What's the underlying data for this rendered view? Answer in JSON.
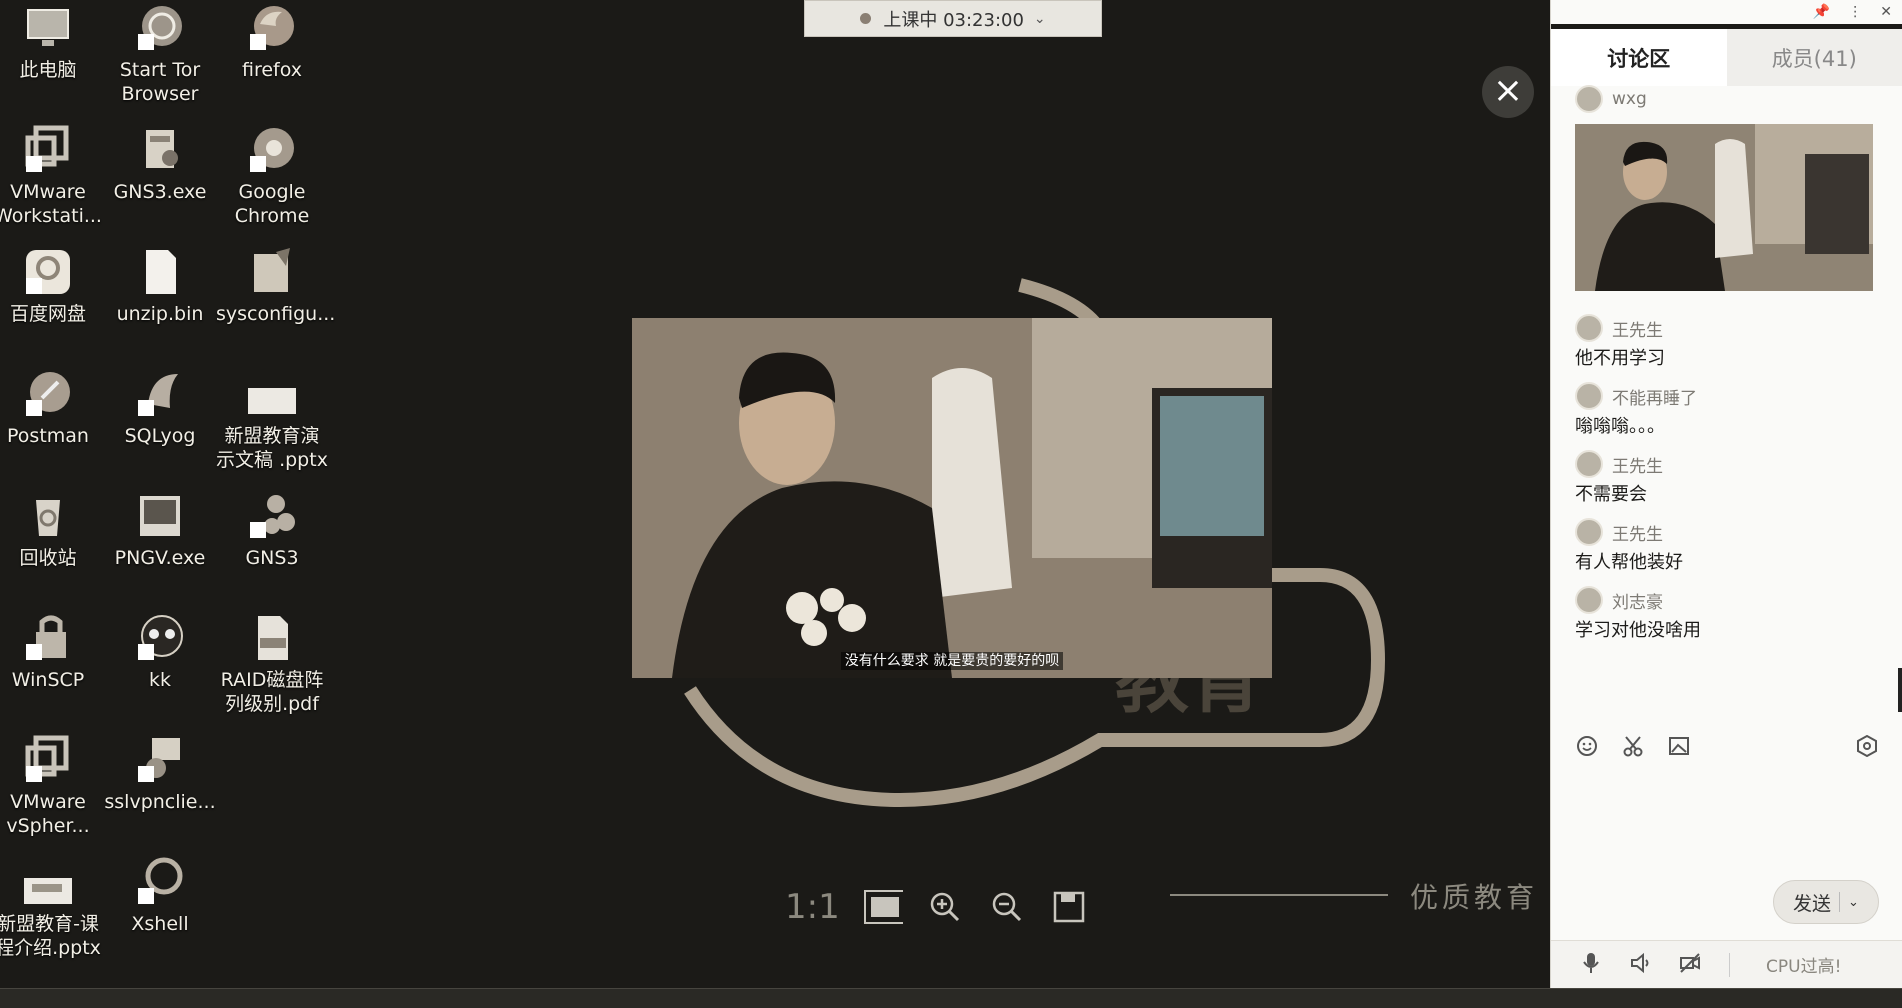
{
  "desktop": {
    "icons": [
      {
        "label": "此电脑",
        "icon": "computer-icon"
      },
      {
        "label": "Start Tor Browser",
        "icon": "tor-browser-icon"
      },
      {
        "label": "firefox",
        "icon": "firefox-icon"
      },
      {
        "label": "VMware Workstati...",
        "icon": "vmware-icon"
      },
      {
        "label": "GNS3.exe",
        "icon": "gns3-exe-icon"
      },
      {
        "label": "Google Chrome",
        "icon": "chrome-icon"
      },
      {
        "label": "百度网盘",
        "icon": "baidu-netdisk-icon"
      },
      {
        "label": "unzip.bin",
        "icon": "file-icon"
      },
      {
        "label": "sysconfigu...",
        "icon": "sysconfig-icon"
      },
      {
        "label": "Postman",
        "icon": "postman-icon"
      },
      {
        "label": "SQLyog",
        "icon": "sqlyog-icon"
      },
      {
        "label": "新盟教育演示文稿 .pptx",
        "icon": "pptx-icon"
      },
      {
        "label": "回收站",
        "icon": "recycle-bin-icon"
      },
      {
        "label": "PNGV.exe",
        "icon": "pngv-icon"
      },
      {
        "label": "GNS3",
        "icon": "gns3-icon"
      },
      {
        "label": "WinSCP",
        "icon": "winscp-icon"
      },
      {
        "label": "kk",
        "icon": "kk-icon"
      },
      {
        "label": "RAID磁盘阵列级别.pdf",
        "icon": "pdf-icon"
      },
      {
        "label": "VMware vSpher...",
        "icon": "vsphere-icon"
      },
      {
        "label": "sslvpnclie...",
        "icon": "sslvpn-icon"
      },
      {
        "label": "新盟教育-课程介绍.pptx",
        "icon": "pptx-icon"
      },
      {
        "label": "Xshell",
        "icon": "xshell-icon"
      }
    ]
  },
  "class_bar": {
    "status": "上课中 03:23:00"
  },
  "viewer": {
    "subtitle": "没有什么要求 就是要贵的要好的呗",
    "ratio_label": "1:1",
    "slogan": "优质教育",
    "logo_text": "教育"
  },
  "panel": {
    "tabs": [
      {
        "label": "讨论区"
      },
      {
        "label": "成员(41)"
      }
    ],
    "messages": [
      {
        "user": "wxg",
        "text": ""
      },
      {
        "user": "王先生",
        "text": "他不用学习"
      },
      {
        "user": "不能再睡了",
        "text": "嗡嗡嗡。。。"
      },
      {
        "user": "王先生",
        "text": "不需要会"
      },
      {
        "user": "王先生",
        "text": "有人帮他装好"
      },
      {
        "user": "刘志豪",
        "text": "学习对他没啥用"
      }
    ],
    "send_label": "发送",
    "cpu_label": "CPU过高!"
  }
}
